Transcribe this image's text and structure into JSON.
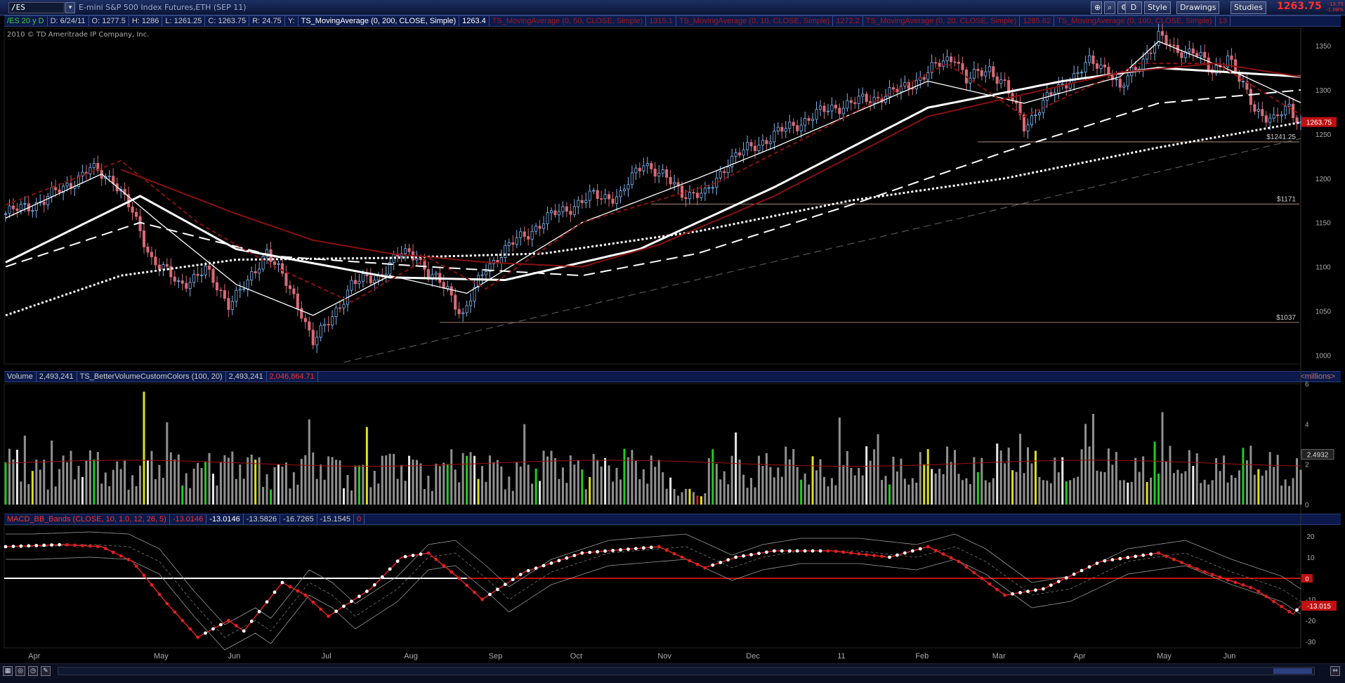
{
  "topbar": {
    "symbol": "/ES",
    "title": "E-mini S&P 500 Index Futures,ETH (SEP 11)",
    "buttons": {
      "aggregation": "D",
      "style": "Style",
      "drawings": "Drawings",
      "studies": "Studies"
    },
    "last_price": "1263.75",
    "change": "-13.75",
    "change_pct": "-1.08%"
  },
  "main_header": {
    "period": "/ES 20 y D",
    "date": "D: 6/24/11",
    "open": "O: 1277.5",
    "high": "H: 1286",
    "low": "L: 1261.25",
    "close": "C: 1263.75",
    "range": "R: 24.75",
    "y": "Y:",
    "ma200": "TS_MovingAverage (0, 200, CLOSE, Simple)",
    "ma200_v": "1263.4",
    "ma50": "TS_MovingAverage (0, 50, CLOSE, Simple)",
    "ma50_v": "1315.1",
    "ma10": "TS_MovingAverage (0, 10, CLOSE, Simple)",
    "ma10_v": "1272.2",
    "ma20": "TS_MovingAverage (0, 20, CLOSE, Simple)",
    "ma20_v": "1285.62",
    "ma100": "TS_MovingAverage (0, 100, CLOSE, Simple)",
    "ma100_v": "13"
  },
  "copyright": "2010 © TD Ameritrade IP Company, Inc.",
  "volume_header": {
    "label": "Volume",
    "value": "2,493,241",
    "study": "TS_BetterVolumeCustomColors (100, 20)",
    "value2": "2,493,241",
    "avg": "2,046,864.71",
    "unit": "<millions>"
  },
  "macd_header": {
    "study": "MACD_BB_Bands (CLOSE, 10, 1.0, 12, 26, 5)",
    "v1": "-13.0146",
    "v2": "-13.0146",
    "v3": "-13.5826",
    "v4": "-16.7265",
    "v5": "-15.1545",
    "v6": "0"
  },
  "colors": {
    "up": "#7fb6f0",
    "down": "#d86a78",
    "ma_red": "#8a1010",
    "bg": "#000000",
    "accent": "#ff2020"
  },
  "chart_data": [
    {
      "type": "candlestick",
      "title": "E-mini S&P 500 Index Futures,ETH (SEP 11)",
      "ylim": [
        990,
        1370
      ],
      "y_ticks": [
        1000,
        1050,
        1100,
        1150,
        1200,
        1250,
        1300,
        1350
      ],
      "x_labels": [
        "Apr",
        "May",
        "Jun",
        "Jul",
        "Aug",
        "Sep",
        "Oct",
        "Nov",
        "Dec",
        "11",
        "Feb",
        "Mar",
        "Apr",
        "May",
        "Jun"
      ],
      "price_levels": [
        {
          "label": "$1241.25",
          "value": 1241.25
        },
        {
          "label": "$1171",
          "value": 1171
        },
        {
          "label": "$1037",
          "value": 1037
        }
      ],
      "last_value": "1263.75",
      "close_anchors": [
        {
          "bar": 0,
          "close": 1160
        },
        {
          "bar": 10,
          "close": 1175
        },
        {
          "bar": 22,
          "close": 1210
        },
        {
          "bar": 28,
          "close": 1200
        },
        {
          "bar": 33,
          "close": 1160
        },
        {
          "bar": 38,
          "close": 1110
        },
        {
          "bar": 45,
          "close": 1080
        },
        {
          "bar": 52,
          "close": 1095
        },
        {
          "bar": 58,
          "close": 1060
        },
        {
          "bar": 63,
          "close": 1080
        },
        {
          "bar": 68,
          "close": 1120
        },
        {
          "bar": 73,
          "close": 1080
        },
        {
          "bar": 77,
          "close": 1050
        },
        {
          "bar": 80,
          "close": 1015
        },
        {
          "bar": 83,
          "close": 1030
        },
        {
          "bar": 90,
          "close": 1080
        },
        {
          "bar": 97,
          "close": 1090
        },
        {
          "bar": 103,
          "close": 1115
        },
        {
          "bar": 107,
          "close": 1115
        },
        {
          "bar": 110,
          "close": 1090
        },
        {
          "bar": 115,
          "close": 1075
        },
        {
          "bar": 119,
          "close": 1045
        },
        {
          "bar": 125,
          "close": 1100
        },
        {
          "bar": 133,
          "close": 1130
        },
        {
          "bar": 143,
          "close": 1160
        },
        {
          "bar": 153,
          "close": 1180
        },
        {
          "bar": 160,
          "close": 1180
        },
        {
          "bar": 166,
          "close": 1220
        },
        {
          "bar": 170,
          "close": 1205
        },
        {
          "bar": 176,
          "close": 1185
        },
        {
          "bar": 182,
          "close": 1180
        },
        {
          "bar": 188,
          "close": 1220
        },
        {
          "bar": 196,
          "close": 1240
        },
        {
          "bar": 205,
          "close": 1260
        },
        {
          "bar": 215,
          "close": 1280
        },
        {
          "bar": 225,
          "close": 1290
        },
        {
          "bar": 233,
          "close": 1300
        },
        {
          "bar": 240,
          "close": 1320
        },
        {
          "bar": 247,
          "close": 1340
        },
        {
          "bar": 250,
          "close": 1310
        },
        {
          "bar": 256,
          "close": 1325
        },
        {
          "bar": 260,
          "close": 1305
        },
        {
          "bar": 265,
          "close": 1260
        },
        {
          "bar": 270,
          "close": 1285
        },
        {
          "bar": 276,
          "close": 1310
        },
        {
          "bar": 282,
          "close": 1330
        },
        {
          "bar": 287,
          "close": 1325
        },
        {
          "bar": 290,
          "close": 1300
        },
        {
          "bar": 295,
          "close": 1330
        },
        {
          "bar": 300,
          "close": 1360
        },
        {
          "bar": 304,
          "close": 1345
        },
        {
          "bar": 309,
          "close": 1345
        },
        {
          "bar": 314,
          "close": 1320
        },
        {
          "bar": 318,
          "close": 1340
        },
        {
          "bar": 321,
          "close": 1310
        },
        {
          "bar": 325,
          "close": 1280
        },
        {
          "bar": 330,
          "close": 1265
        },
        {
          "bar": 334,
          "close": 1280
        },
        {
          "bar": 337,
          "close": 1263.75
        }
      ],
      "moving_averages": [
        {
          "name": "MA200",
          "style": "white-dotted",
          "points": [
            [
              0,
              1045
            ],
            [
              30,
              1090
            ],
            [
              60,
              1108
            ],
            [
              100,
              1110
            ],
            [
              140,
              1115
            ],
            [
              180,
              1140
            ],
            [
              220,
              1175
            ],
            [
              260,
              1200
            ],
            [
              300,
              1235
            ],
            [
              337,
              1263.4
            ]
          ]
        },
        {
          "name": "MA100",
          "style": "white-dashed",
          "points": [
            [
              0,
              1100
            ],
            [
              35,
              1150
            ],
            [
              70,
              1112
            ],
            [
              110,
              1100
            ],
            [
              150,
              1090
            ],
            [
              180,
              1115
            ],
            [
              220,
              1170
            ],
            [
              260,
              1230
            ],
            [
              300,
              1285
            ],
            [
              337,
              1300
            ]
          ]
        },
        {
          "name": "MA50",
          "style": "white-solid",
          "points": [
            [
              0,
              1105
            ],
            [
              35,
              1180
            ],
            [
              60,
              1120
            ],
            [
              100,
              1088
            ],
            [
              130,
              1085
            ],
            [
              165,
              1120
            ],
            [
              200,
              1190
            ],
            [
              240,
              1280
            ],
            [
              275,
              1310
            ],
            [
              300,
              1325
            ],
            [
              337,
              1315.1
            ]
          ]
        },
        {
          "name": "MA20",
          "style": "white-thin",
          "points": [
            [
              0,
              1155
            ],
            [
              25,
              1205
            ],
            [
              40,
              1150
            ],
            [
              60,
              1080
            ],
            [
              80,
              1045
            ],
            [
              100,
              1090
            ],
            [
              120,
              1070
            ],
            [
              150,
              1150
            ],
            [
              180,
              1200
            ],
            [
              200,
              1235
            ],
            [
              240,
              1310
            ],
            [
              265,
              1285
            ],
            [
              290,
              1315
            ],
            [
              300,
              1355
            ],
            [
              320,
              1320
            ],
            [
              337,
              1285.62
            ]
          ]
        },
        {
          "name": "MA10",
          "style": "red-dashed",
          "points": [
            [
              0,
              1170
            ],
            [
              30,
              1220
            ],
            [
              50,
              1150
            ],
            [
              70,
              1100
            ],
            [
              90,
              1060
            ],
            [
              110,
              1110
            ],
            [
              125,
              1075
            ],
            [
              150,
              1150
            ],
            [
              185,
              1195
            ],
            [
              210,
              1250
            ],
            [
              245,
              1330
            ],
            [
              265,
              1270
            ],
            [
              295,
              1330
            ],
            [
              315,
              1330
            ],
            [
              330,
              1290
            ],
            [
              337,
              1272.2
            ]
          ]
        },
        {
          "name": "MA50r",
          "style": "red-solid",
          "points": [
            [
              30,
              1210
            ],
            [
              60,
              1160
            ],
            [
              80,
              1130
            ],
            [
              100,
              1115
            ],
            [
              125,
              1105
            ],
            [
              150,
              1100
            ],
            [
              170,
              1125
            ],
            [
              200,
              1180
            ],
            [
              240,
              1270
            ],
            [
              290,
              1320
            ],
            [
              315,
              1330
            ],
            [
              337,
              1315
            ]
          ]
        }
      ]
    },
    {
      "type": "bar",
      "title": "Volume",
      "ylim": [
        0,
        6
      ],
      "y_ticks": [
        0,
        2,
        4,
        6
      ],
      "unit": "millions",
      "last_value": "2.4932",
      "average_line": 2.05,
      "note": "one bar per trading day; colors gray/white/green/yellow/red"
    },
    {
      "type": "line",
      "title": "MACD_BB_Bands (CLOSE, 10, 1.0, 12, 26, 5)",
      "ylim": [
        -33,
        25
      ],
      "y_ticks": [
        -30,
        -20,
        -10,
        0,
        10,
        20
      ],
      "last_value": "-13.015",
      "anchors": [
        [
          0,
          15
        ],
        [
          15,
          16
        ],
        [
          25,
          15
        ],
        [
          33,
          8
        ],
        [
          42,
          -12
        ],
        [
          50,
          -28
        ],
        [
          58,
          -20
        ],
        [
          62,
          -25
        ],
        [
          72,
          -2
        ],
        [
          78,
          -8
        ],
        [
          84,
          -18
        ],
        [
          95,
          -5
        ],
        [
          103,
          10
        ],
        [
          110,
          12
        ],
        [
          118,
          0
        ],
        [
          124,
          -10
        ],
        [
          135,
          3
        ],
        [
          150,
          12
        ],
        [
          170,
          15
        ],
        [
          182,
          5
        ],
        [
          190,
          10
        ],
        [
          200,
          13
        ],
        [
          215,
          13
        ],
        [
          230,
          10
        ],
        [
          240,
          15
        ],
        [
          248,
          8
        ],
        [
          260,
          -8
        ],
        [
          270,
          -5
        ],
        [
          285,
          8
        ],
        [
          300,
          12
        ],
        [
          312,
          3
        ],
        [
          325,
          -5
        ],
        [
          335,
          -17
        ],
        [
          337,
          -13
        ]
      ]
    }
  ],
  "bottom_bar": {
    "icons": [
      "grid-icon",
      "globe-icon",
      "clock-icon",
      "pencil-icon"
    ]
  }
}
